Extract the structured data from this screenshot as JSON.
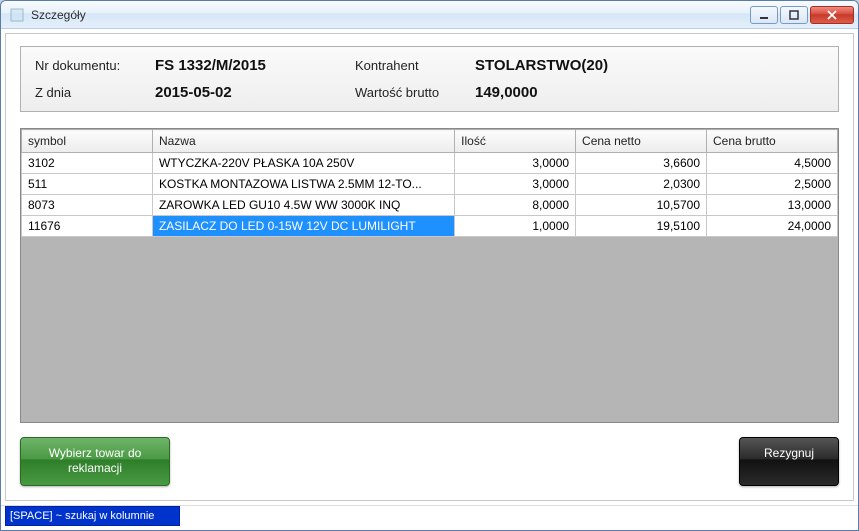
{
  "window": {
    "title": "Szczegóły"
  },
  "header": {
    "doc_label": "Nr dokumentu:",
    "doc_value": "FS 1332/M/2015",
    "contractor_label": "Kontrahent",
    "contractor_value": "STOLARSTWO(20)",
    "date_label": "Z dnia",
    "date_value": "2015-05-02",
    "gross_label": "Wartość brutto",
    "gross_value": "149,0000"
  },
  "grid": {
    "columns": {
      "symbol": "symbol",
      "name": "Nazwa",
      "qty": "Ilość",
      "net": "Cena netto",
      "gross": "Cena brutto"
    },
    "rows": [
      {
        "symbol": "3102",
        "name": "WTYCZKA-220V PŁASKA 10A 250V",
        "qty": "3,0000",
        "net": "3,6600",
        "gross": "4,5000"
      },
      {
        "symbol": "511",
        "name": "KOSTKA MONTAZOWA LISTWA 2.5MM 12-TO...",
        "qty": "3,0000",
        "net": "2,0300",
        "gross": "2,5000"
      },
      {
        "symbol": "8073",
        "name": "ZAROWKA LED GU10 4.5W WW 3000K  INQ",
        "qty": "8,0000",
        "net": "10,5700",
        "gross": "13,0000"
      },
      {
        "symbol": "11676",
        "name": "ZASILACZ DO LED 0-15W 12V DC  LUMILIGHT",
        "qty": "1,0000",
        "net": "19,5100",
        "gross": "24,0000"
      }
    ],
    "selected_index": 3
  },
  "buttons": {
    "select": "Wybierz towar do reklamacji",
    "cancel": "Rezygnuj"
  },
  "status": {
    "hint": "[SPACE] ~ szukaj w kolumnie"
  }
}
